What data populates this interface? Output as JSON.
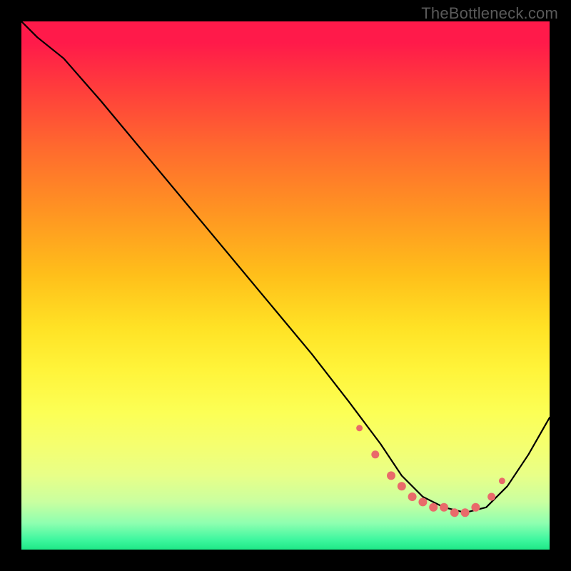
{
  "watermark": "TheBottleneck.com",
  "colors": {
    "page_bg": "#000000",
    "watermark_text": "#5a5a5a",
    "curve_stroke": "#000000",
    "dot_fill": "#e96a6a",
    "gradient_top": "#ff1a4a",
    "gradient_mid": "#fff43a",
    "gradient_bottom": "#1ee887"
  },
  "chart_data": {
    "type": "line",
    "title": "",
    "xlabel": "",
    "ylabel": "",
    "xlim": [
      0,
      100
    ],
    "ylim": [
      0,
      100
    ],
    "grid": false,
    "legend": false,
    "note": "Axes have no visible tick labels; x/y are normalized 0–100 percent based on position within the plot area. y=100 at top (red), y=0 at bottom (green). Curve descends from top-left, flattens near bottom around x≈70–88, then rises toward bottom-right. Dots cluster along the flat trough.",
    "series": [
      {
        "name": "curve",
        "x": [
          0,
          3,
          8,
          15,
          25,
          35,
          45,
          55,
          62,
          68,
          72,
          76,
          80,
          84,
          88,
          92,
          96,
          100
        ],
        "y": [
          100,
          97,
          93,
          85,
          73,
          61,
          49,
          37,
          28,
          20,
          14,
          10,
          8,
          7,
          8,
          12,
          18,
          25
        ]
      }
    ],
    "dots": {
      "name": "highlight-points",
      "x": [
        64,
        67,
        70,
        72,
        74,
        76,
        78,
        80,
        82,
        84,
        86,
        89,
        91
      ],
      "y": [
        23,
        18,
        14,
        12,
        10,
        9,
        8,
        8,
        7,
        7,
        8,
        10,
        13
      ],
      "r": [
        4.5,
        5.5,
        6,
        6,
        6,
        6,
        6,
        6,
        6,
        6,
        6,
        5.5,
        4.5
      ]
    }
  }
}
